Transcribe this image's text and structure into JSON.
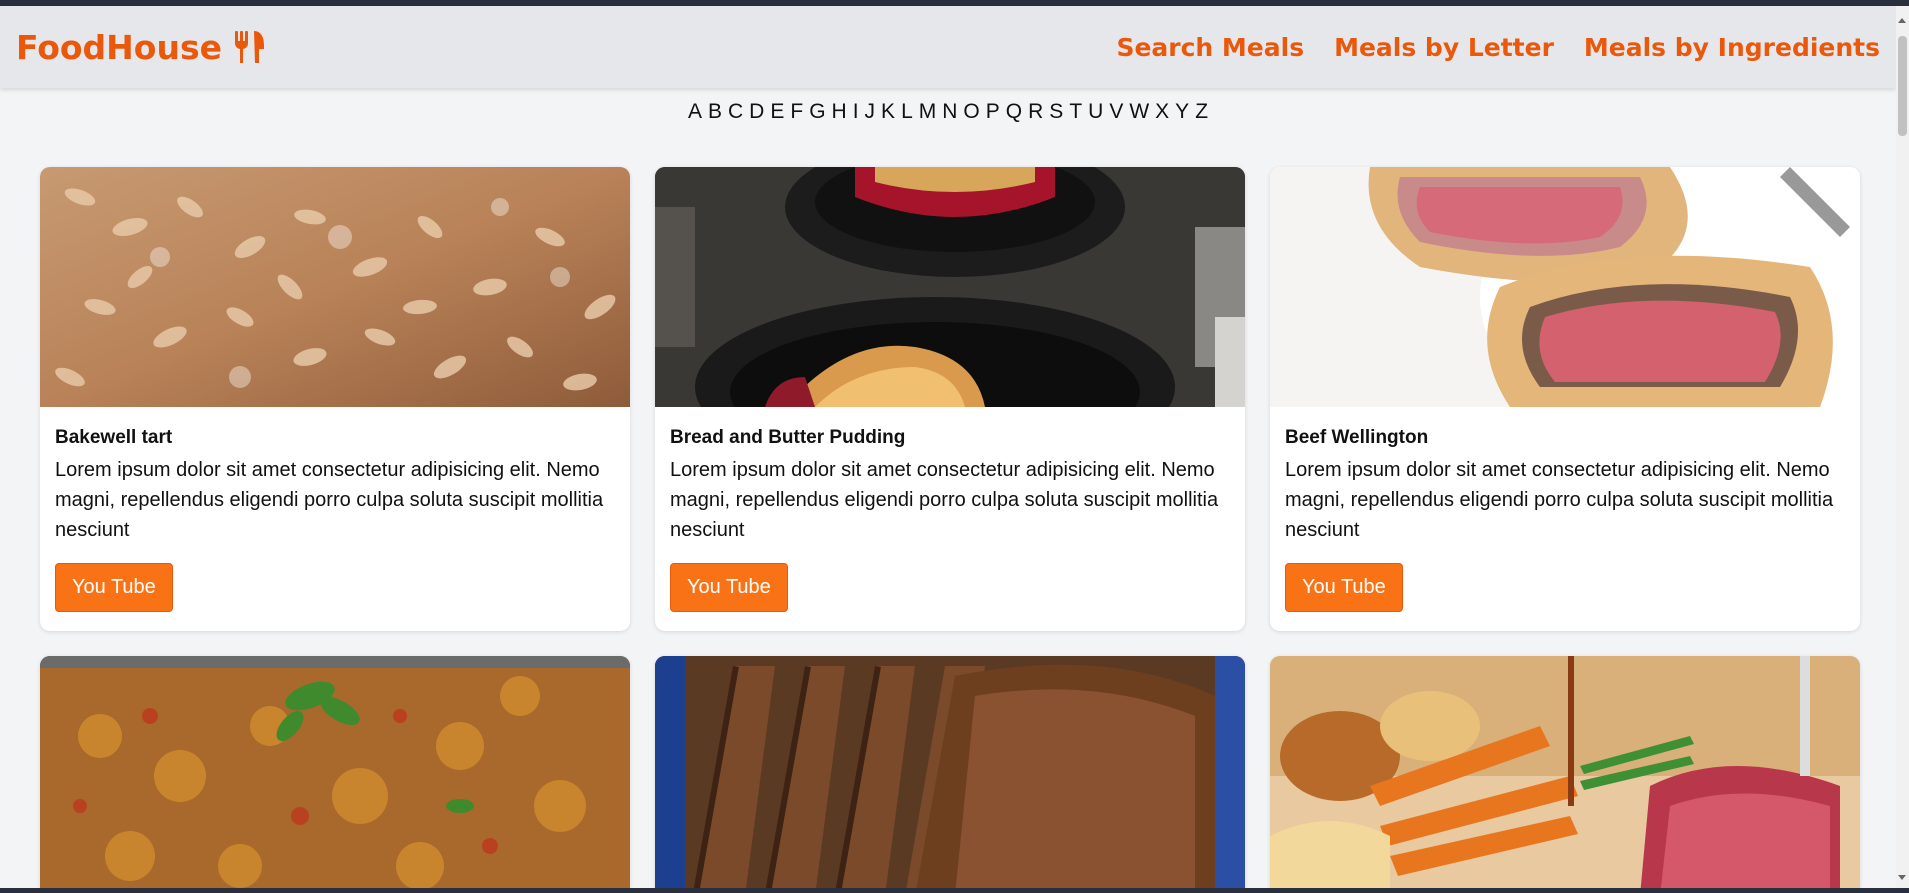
{
  "brand": {
    "name": "FoodHouse",
    "icon": "fork-knife-icon",
    "color": "#ea580c"
  },
  "nav": {
    "links": [
      "Search Meals",
      "Meals by Letter",
      "Meals by Ingredients"
    ]
  },
  "letters": [
    "A",
    "B",
    "C",
    "D",
    "E",
    "F",
    "G",
    "H",
    "I",
    "J",
    "K",
    "L",
    "M",
    "N",
    "O",
    "P",
    "Q",
    "R",
    "S",
    "T",
    "U",
    "V",
    "W",
    "X",
    "Y",
    "Z"
  ],
  "meals": [
    {
      "title": "Bakewell tart",
      "description": "Lorem ipsum dolor sit amet consectetur adipisicing elit. Nemo magni, repellendus eligendi porro culpa soluta suscipit mollitia nesciunt",
      "button": "You Tube"
    },
    {
      "title": "Bread and Butter Pudding",
      "description": "Lorem ipsum dolor sit amet consectetur adipisicing elit. Nemo magni, repellendus eligendi porro culpa soluta suscipit mollitia nesciunt",
      "button": "You Tube"
    },
    {
      "title": "Beef Wellington",
      "description": "Lorem ipsum dolor sit amet consectetur adipisicing elit. Nemo magni, repellendus eligendi porro culpa soluta suscipit mollitia nesciunt",
      "button": "You Tube"
    },
    {
      "title": "",
      "description": "",
      "button": ""
    },
    {
      "title": "",
      "description": "",
      "button": ""
    },
    {
      "title": "",
      "description": "",
      "button": ""
    }
  ],
  "colors": {
    "accent": "#f97316",
    "background": "#f3f4f6",
    "navbar": "#e5e7eb"
  }
}
